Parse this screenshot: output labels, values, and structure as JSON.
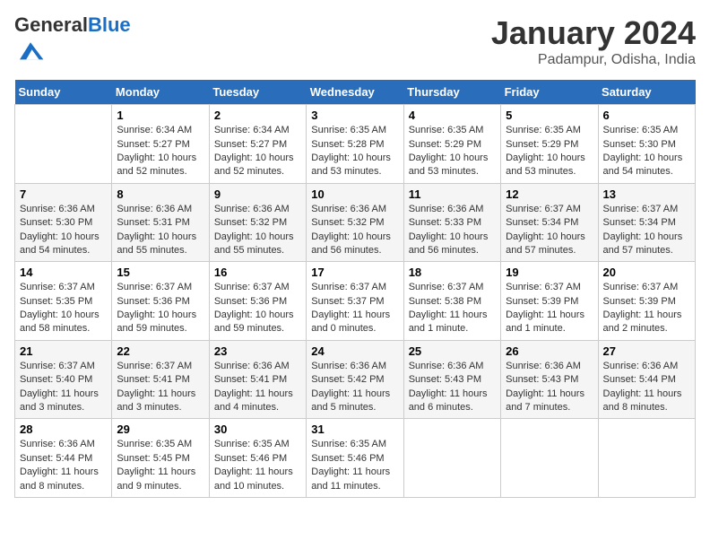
{
  "header": {
    "logo_general": "General",
    "logo_blue": "Blue",
    "month_title": "January 2024",
    "subtitle": "Padampur, Odisha, India"
  },
  "days_of_week": [
    "Sunday",
    "Monday",
    "Tuesday",
    "Wednesday",
    "Thursday",
    "Friday",
    "Saturday"
  ],
  "weeks": [
    [
      {
        "day": "",
        "info": ""
      },
      {
        "day": "1",
        "info": "Sunrise: 6:34 AM\nSunset: 5:27 PM\nDaylight: 10 hours\nand 52 minutes."
      },
      {
        "day": "2",
        "info": "Sunrise: 6:34 AM\nSunset: 5:27 PM\nDaylight: 10 hours\nand 52 minutes."
      },
      {
        "day": "3",
        "info": "Sunrise: 6:35 AM\nSunset: 5:28 PM\nDaylight: 10 hours\nand 53 minutes."
      },
      {
        "day": "4",
        "info": "Sunrise: 6:35 AM\nSunset: 5:29 PM\nDaylight: 10 hours\nand 53 minutes."
      },
      {
        "day": "5",
        "info": "Sunrise: 6:35 AM\nSunset: 5:29 PM\nDaylight: 10 hours\nand 53 minutes."
      },
      {
        "day": "6",
        "info": "Sunrise: 6:35 AM\nSunset: 5:30 PM\nDaylight: 10 hours\nand 54 minutes."
      }
    ],
    [
      {
        "day": "7",
        "info": "Sunrise: 6:36 AM\nSunset: 5:30 PM\nDaylight: 10 hours\nand 54 minutes."
      },
      {
        "day": "8",
        "info": "Sunrise: 6:36 AM\nSunset: 5:31 PM\nDaylight: 10 hours\nand 55 minutes."
      },
      {
        "day": "9",
        "info": "Sunrise: 6:36 AM\nSunset: 5:32 PM\nDaylight: 10 hours\nand 55 minutes."
      },
      {
        "day": "10",
        "info": "Sunrise: 6:36 AM\nSunset: 5:32 PM\nDaylight: 10 hours\nand 56 minutes."
      },
      {
        "day": "11",
        "info": "Sunrise: 6:36 AM\nSunset: 5:33 PM\nDaylight: 10 hours\nand 56 minutes."
      },
      {
        "day": "12",
        "info": "Sunrise: 6:37 AM\nSunset: 5:34 PM\nDaylight: 10 hours\nand 57 minutes."
      },
      {
        "day": "13",
        "info": "Sunrise: 6:37 AM\nSunset: 5:34 PM\nDaylight: 10 hours\nand 57 minutes."
      }
    ],
    [
      {
        "day": "14",
        "info": "Sunrise: 6:37 AM\nSunset: 5:35 PM\nDaylight: 10 hours\nand 58 minutes."
      },
      {
        "day": "15",
        "info": "Sunrise: 6:37 AM\nSunset: 5:36 PM\nDaylight: 10 hours\nand 59 minutes."
      },
      {
        "day": "16",
        "info": "Sunrise: 6:37 AM\nSunset: 5:36 PM\nDaylight: 10 hours\nand 59 minutes."
      },
      {
        "day": "17",
        "info": "Sunrise: 6:37 AM\nSunset: 5:37 PM\nDaylight: 11 hours\nand 0 minutes."
      },
      {
        "day": "18",
        "info": "Sunrise: 6:37 AM\nSunset: 5:38 PM\nDaylight: 11 hours\nand 1 minute."
      },
      {
        "day": "19",
        "info": "Sunrise: 6:37 AM\nSunset: 5:39 PM\nDaylight: 11 hours\nand 1 minute."
      },
      {
        "day": "20",
        "info": "Sunrise: 6:37 AM\nSunset: 5:39 PM\nDaylight: 11 hours\nand 2 minutes."
      }
    ],
    [
      {
        "day": "21",
        "info": "Sunrise: 6:37 AM\nSunset: 5:40 PM\nDaylight: 11 hours\nand 3 minutes."
      },
      {
        "day": "22",
        "info": "Sunrise: 6:37 AM\nSunset: 5:41 PM\nDaylight: 11 hours\nand 3 minutes."
      },
      {
        "day": "23",
        "info": "Sunrise: 6:36 AM\nSunset: 5:41 PM\nDaylight: 11 hours\nand 4 minutes."
      },
      {
        "day": "24",
        "info": "Sunrise: 6:36 AM\nSunset: 5:42 PM\nDaylight: 11 hours\nand 5 minutes."
      },
      {
        "day": "25",
        "info": "Sunrise: 6:36 AM\nSunset: 5:43 PM\nDaylight: 11 hours\nand 6 minutes."
      },
      {
        "day": "26",
        "info": "Sunrise: 6:36 AM\nSunset: 5:43 PM\nDaylight: 11 hours\nand 7 minutes."
      },
      {
        "day": "27",
        "info": "Sunrise: 6:36 AM\nSunset: 5:44 PM\nDaylight: 11 hours\nand 8 minutes."
      }
    ],
    [
      {
        "day": "28",
        "info": "Sunrise: 6:36 AM\nSunset: 5:44 PM\nDaylight: 11 hours\nand 8 minutes."
      },
      {
        "day": "29",
        "info": "Sunrise: 6:35 AM\nSunset: 5:45 PM\nDaylight: 11 hours\nand 9 minutes."
      },
      {
        "day": "30",
        "info": "Sunrise: 6:35 AM\nSunset: 5:46 PM\nDaylight: 11 hours\nand 10 minutes."
      },
      {
        "day": "31",
        "info": "Sunrise: 6:35 AM\nSunset: 5:46 PM\nDaylight: 11 hours\nand 11 minutes."
      },
      {
        "day": "",
        "info": ""
      },
      {
        "day": "",
        "info": ""
      },
      {
        "day": "",
        "info": ""
      }
    ]
  ]
}
